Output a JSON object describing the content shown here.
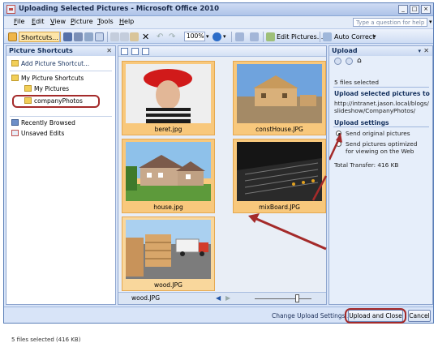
{
  "window": {
    "title": "Uploading Selected Pictures - Microsoft Office 2010",
    "controls": [
      "_",
      "□",
      "×"
    ]
  },
  "menu": [
    "File",
    "Edit",
    "View",
    "Picture",
    "Tools",
    "Help"
  ],
  "help_placeholder": "Type a question for help",
  "toolbar": {
    "shortcuts_label": "Shortcuts...",
    "zoom": "100%",
    "edit_pictures_label": "Edit Pictures...",
    "auto_correct_label": "Auto Correct"
  },
  "left_pane": {
    "title": "Picture Shortcuts",
    "add_shortcut": "Add Picture Shortcut...",
    "my_shortcuts": "My Picture Shortcuts",
    "my_pictures": "My Pictures",
    "company_photos": "companyPhotos",
    "recently_browsed": "Recently Browsed",
    "unsaved_edits": "Unsaved Edits",
    "status": "5 files selected (416 KB)"
  },
  "thumbnails": [
    {
      "caption": "beret.jpg"
    },
    {
      "caption": "constHouse.JPG"
    },
    {
      "caption": "house.jpg"
    },
    {
      "caption": "mixBoard.JPG"
    },
    {
      "caption": "wood.JPG"
    }
  ],
  "center_footer": {
    "filename": "wood.JPG"
  },
  "right_pane": {
    "title": "Upload",
    "files_selected": "5 files selected",
    "upload_heading": "Upload selected pictures to",
    "upload_url": "http://intranet.jason.local/blogs/slideshow/CompanyPhotos/",
    "settings_heading": "Upload settings",
    "option_original": "Send original pictures",
    "option_optimized": "Send pictures optimized for viewing on the Web",
    "total_transfer": "Total Transfer:   416 KB"
  },
  "bottom": {
    "change_settings": "Change Upload Settings...",
    "upload_close": "Upload and Close",
    "cancel": "Cancel"
  }
}
